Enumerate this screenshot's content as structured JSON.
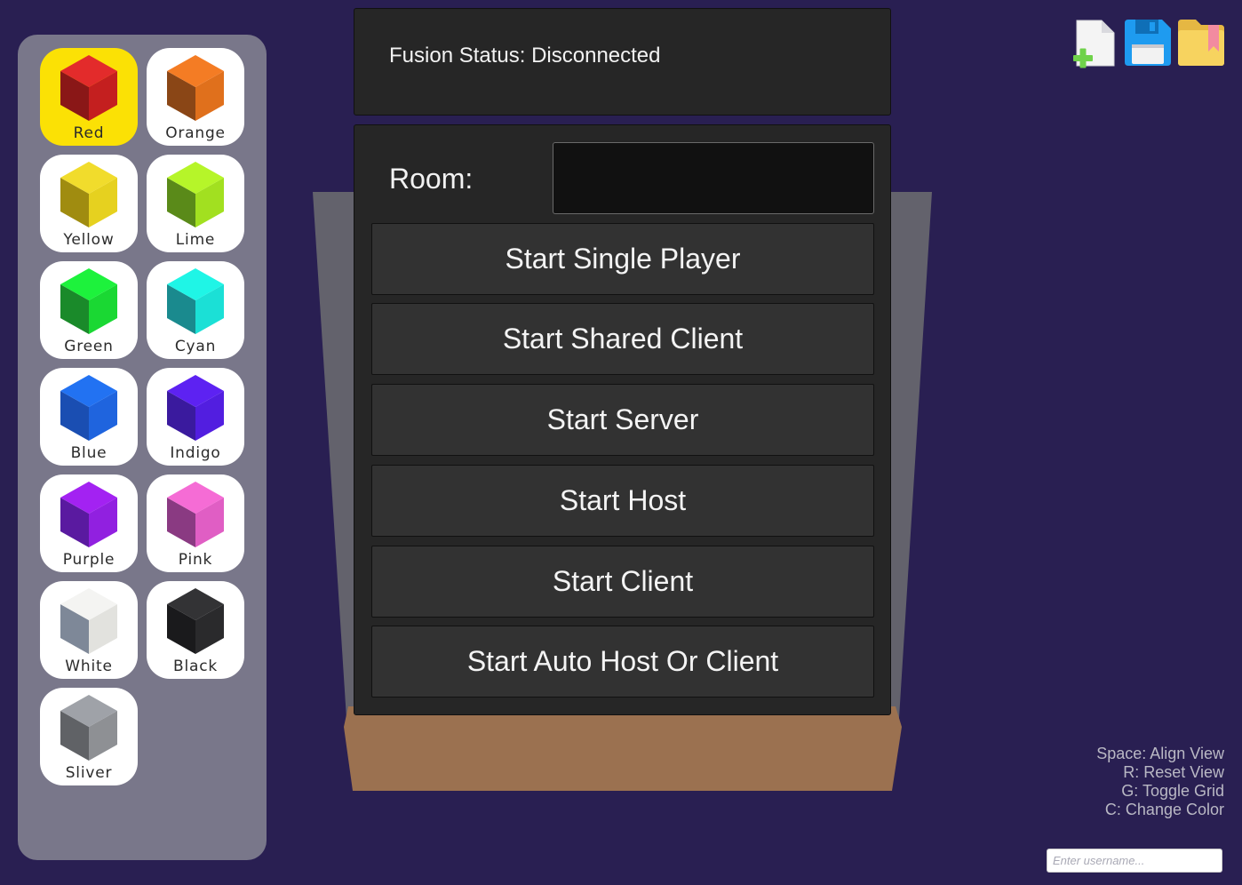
{
  "status": {
    "text": "Fusion Status: Disconnected"
  },
  "room": {
    "label": "Room:",
    "value": ""
  },
  "buttons": [
    "Start Single Player",
    "Start Shared Client",
    "Start Server",
    "Start Host",
    "Start Client",
    "Start Auto Host Or Client"
  ],
  "palette": {
    "selected": "Red",
    "colors": [
      {
        "name": "Red",
        "top": "#e32b2b",
        "left": "#8a1717",
        "right": "#c41f1f"
      },
      {
        "name": "Orange",
        "top": "#f47c24",
        "left": "#8a4616",
        "right": "#e0701c"
      },
      {
        "name": "Yellow",
        "top": "#f1dc2c",
        "left": "#a08c10",
        "right": "#e6d11f"
      },
      {
        "name": "Lime",
        "top": "#b6f529",
        "left": "#5a8a19",
        "right": "#a2e020"
      },
      {
        "name": "Green",
        "top": "#1df23c",
        "left": "#1a8a2a",
        "right": "#1ad833"
      },
      {
        "name": "Cyan",
        "top": "#1ff5e6",
        "left": "#1a8a8e",
        "right": "#1be0d6"
      },
      {
        "name": "Blue",
        "top": "#2272f2",
        "left": "#1a4eb2",
        "right": "#1f64de"
      },
      {
        "name": "Indigo",
        "top": "#5d22f2",
        "left": "#3a1a9e",
        "right": "#521ee0"
      },
      {
        "name": "Purple",
        "top": "#a322f2",
        "left": "#5a1aa0",
        "right": "#9120e0"
      },
      {
        "name": "Pink",
        "top": "#f56cd5",
        "left": "#8a3a82",
        "right": "#e05ec4"
      },
      {
        "name": "White",
        "top": "#f4f4f2",
        "left": "#7e8898",
        "right": "#e2e2de"
      },
      {
        "name": "Black",
        "top": "#333335",
        "left": "#1a1a1c",
        "right": "#2a2a2c"
      },
      {
        "name": "Sliver",
        "top": "#9fa2a8",
        "left": "#606266",
        "right": "#8e9094"
      }
    ]
  },
  "toolbar": {
    "icons": [
      "new-file-icon",
      "save-icon",
      "open-folder-icon"
    ],
    "colors": {
      "save": "#1e9bf0",
      "folder": "#f7d35f",
      "bookmark": "#f28ba0",
      "plus": "#6fd24a"
    }
  },
  "hints": [
    "Space: Align View",
    "R: Reset View",
    "G: Toggle Grid",
    "C: Change Color"
  ],
  "username": {
    "placeholder": "Enter username..."
  }
}
